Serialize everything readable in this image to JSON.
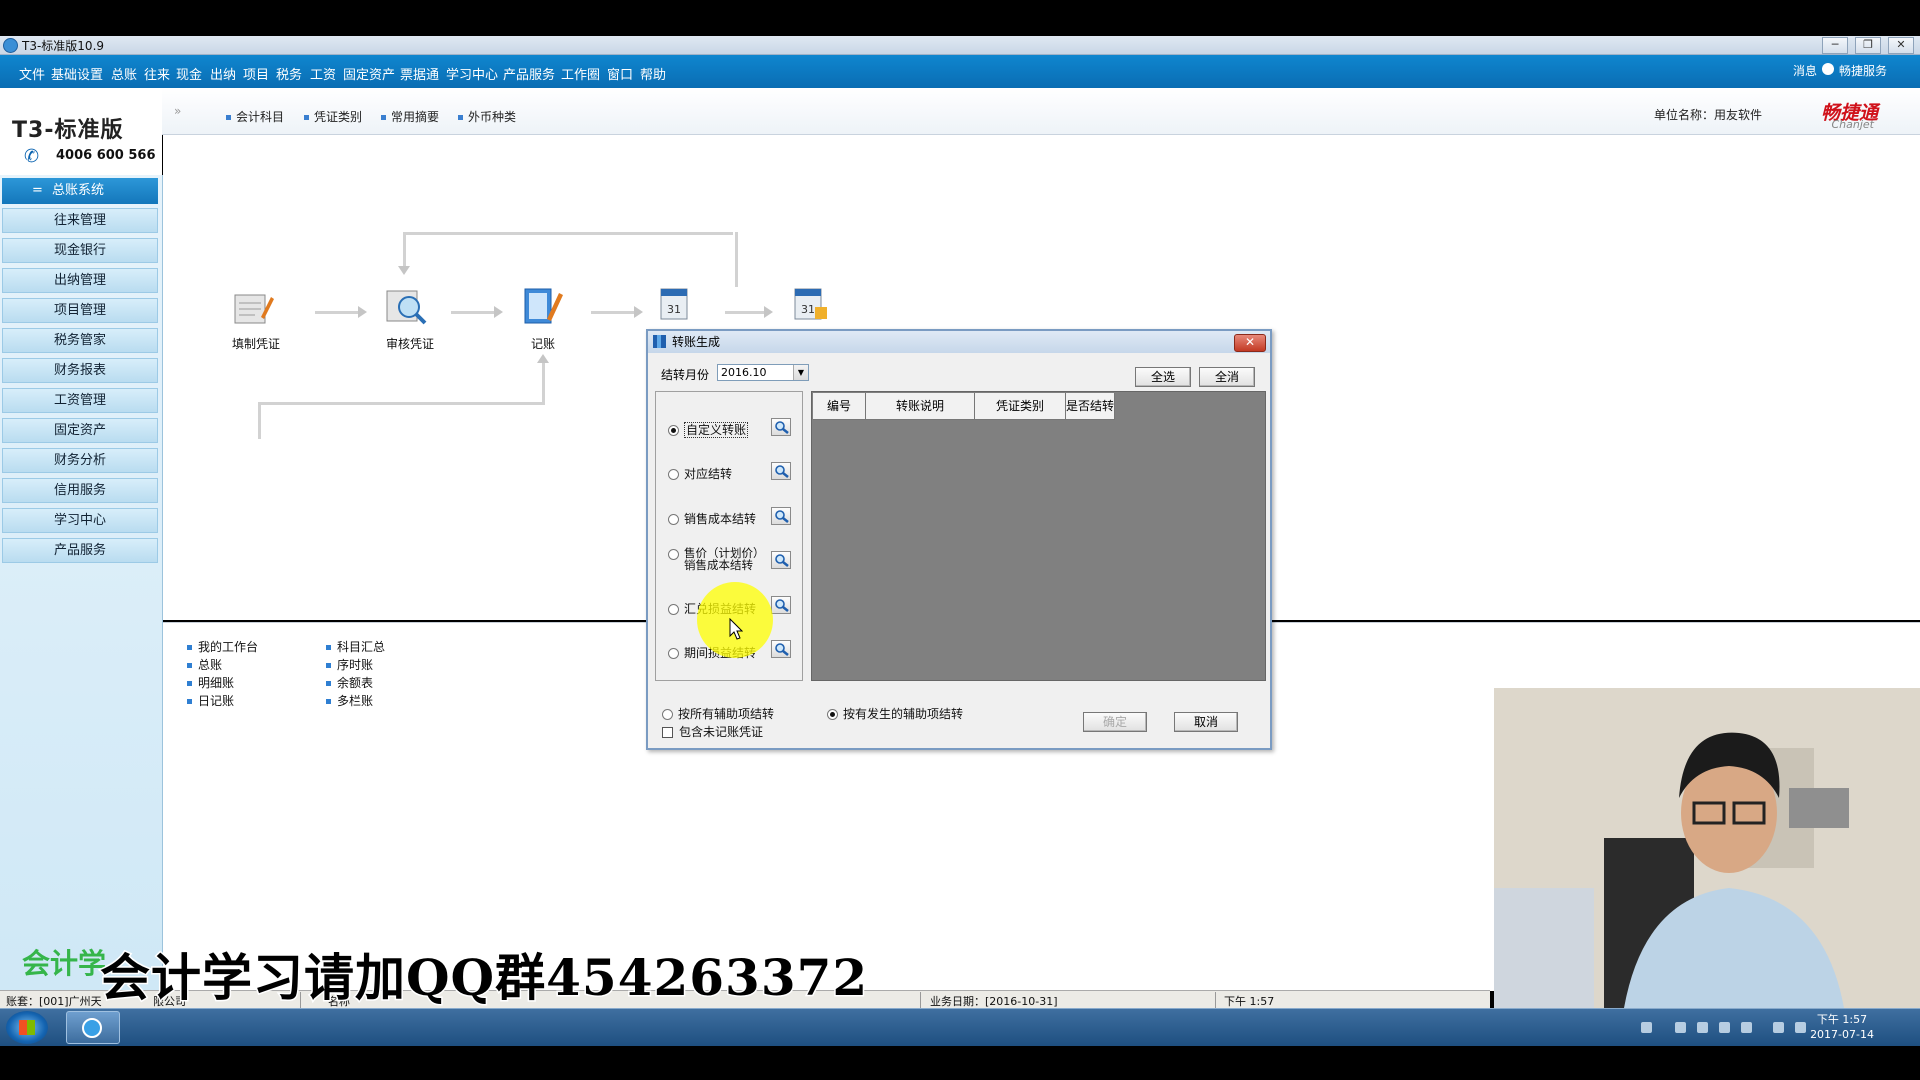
{
  "window": {
    "title": "T3-标准版10.9",
    "controls": [
      "─",
      "❐",
      "✕"
    ]
  },
  "menubar": {
    "items": [
      "文件",
      "基础设置",
      "总账",
      "往来",
      "现金",
      "出纳",
      "项目",
      "税务",
      "工资",
      "固定资产",
      "票据通",
      "学习中心",
      "产品服务",
      "工作圈",
      "窗口",
      "帮助"
    ],
    "right_items": [
      "消息",
      "畅捷服务"
    ]
  },
  "logo": {
    "brand": "T3-标准版",
    "phone": "4006 600 566"
  },
  "toolbar": {
    "expand": "»",
    "items": [
      "会计科目",
      "凭证类别",
      "常用摘要",
      "外币种类"
    ],
    "unit_label": "单位名称：用友软件",
    "chanjet_cn": "畅捷通",
    "chanjet_en": "Chanjet"
  },
  "sidebar": {
    "header": "总账系统",
    "items": [
      "往来管理",
      "现金银行",
      "出纳管理",
      "项目管理",
      "税务管家",
      "财务报表",
      "工资管理",
      "固定资产",
      "财务分析",
      "信用服务",
      "学习中心",
      "产品服务"
    ],
    "watermark": "会计学"
  },
  "flow": {
    "steps": [
      "填制凭证",
      "审核凭证",
      "记账"
    ]
  },
  "lower_links": {
    "col1": [
      "我的工作台",
      "总账",
      "明细账",
      "日记账"
    ],
    "col2": [
      "科目汇总",
      "序时账",
      "余额表",
      "多栏账"
    ]
  },
  "dialog": {
    "title": "转账生成",
    "month_label": "结转月份",
    "month_value": "2016.10",
    "select_all": "全选",
    "deselect_all": "全消",
    "options": [
      {
        "label": "自定义转账",
        "selected": true
      },
      {
        "label": "对应结转",
        "selected": false
      },
      {
        "label": "销售成本结转",
        "selected": false
      },
      {
        "label": "售价（计划价）销售成本结转",
        "selected": false
      },
      {
        "label": "汇兑损益结转",
        "selected": false
      },
      {
        "label": "期间损益结转",
        "selected": false
      }
    ],
    "columns": [
      "编号",
      "转账说明",
      "凭证类别",
      "是否结转"
    ],
    "radio_all": "按所有辅助项结转",
    "radio_occurred": "按有发生的辅助项结转",
    "include_unposted": "包含未记账凭证",
    "ok": "确定",
    "cancel": "取消"
  },
  "statusbar": {
    "account": "账套：[001]广州天",
    "account_tail": "限公司",
    "name_label": "名称",
    "business_date": "业务日期：[2016-10-31]",
    "time": "下午 1:57"
  },
  "taskbar": {
    "time": "下午 1:57",
    "date": "2017-07-14"
  },
  "overlay": {
    "subtitle": "会计学习请加QQ群454263372"
  }
}
